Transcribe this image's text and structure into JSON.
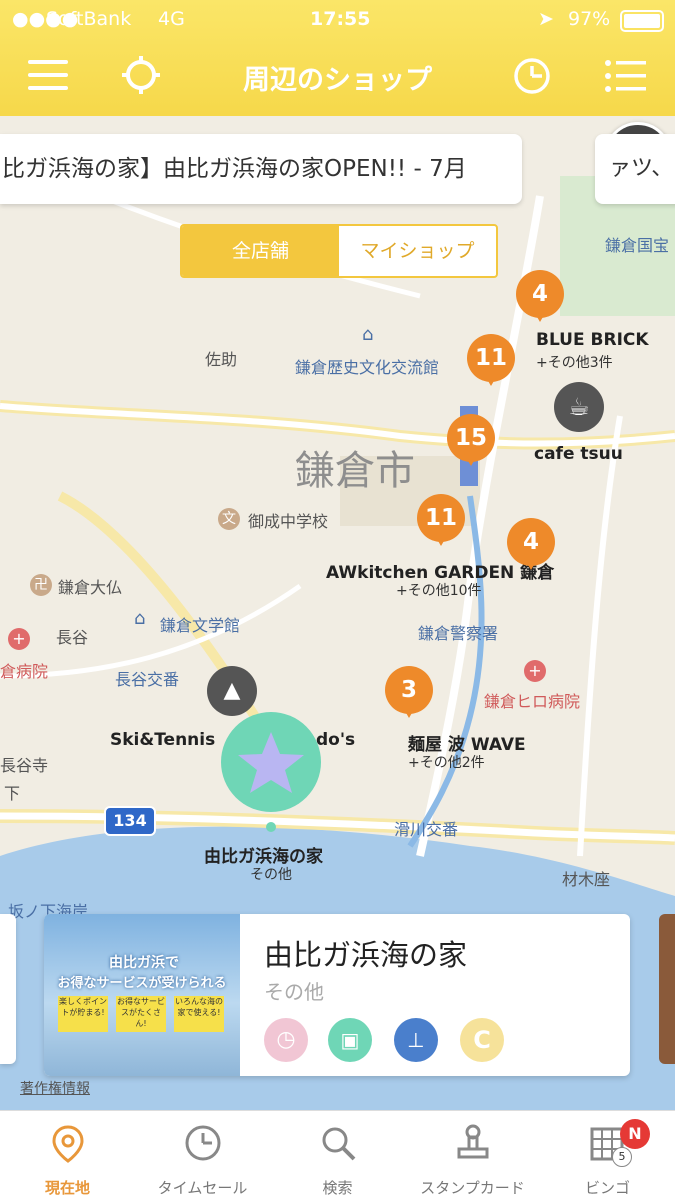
{
  "status_bar": {
    "carrier": "SoftBank",
    "network": "4G",
    "time": "17:55",
    "battery": "97%"
  },
  "header": {
    "title": "周辺のショップ"
  },
  "ticker": {
    "text": "比ガ浜海の家】由比ガ浜海の家OPEN!! - 7月",
    "text2": "ァツ、"
  },
  "segment": {
    "all_label": "全店舗",
    "my_label": "マイショップ"
  },
  "map_labels": {
    "sasuke": "佐助",
    "kamakura_city": "鎌倉市",
    "kamakura_history": "鎌倉歴史文化交流館",
    "onari": "御成中学校",
    "daibutsu": "鎌倉大仏",
    "hase": "長谷",
    "bungakukan": "鎌倉文学館",
    "hase_koban": "長谷交番",
    "hospital_left": "倉病院",
    "hasedera": "長谷寺",
    "shita": "下",
    "kokuho": "鎌倉国宝",
    "police": "鎌倉警察署",
    "hiro_hospital": "鎌倉ヒロ病院",
    "namerikawa": "滑川交番",
    "zaimokuza": "材木座",
    "sakanoshita": "坂ノ下海岸",
    "route": "134",
    "copyright": "著作権情報"
  },
  "shops": {
    "blue_brick": {
      "name": "BLUE BRICK",
      "sub": "+その他3件",
      "count": "4"
    },
    "count11a": "11",
    "count15": "15",
    "cafe": {
      "name": "cafe tsuu"
    },
    "awkitchen": {
      "name": "AWkitchen GARDEN 鎌倉",
      "sub": "+その他10件",
      "count": "11"
    },
    "count4b": "4",
    "wave": {
      "name": "麺屋 波 WAVE",
      "sub": "+その他2件",
      "count": "3"
    },
    "skitennis": {
      "name": "Ski&Tennis",
      "name2": "do's"
    },
    "yuigahama": {
      "name": "由比ガ浜海の家",
      "sub": "その他"
    }
  },
  "card": {
    "title": "由比ガ浜海の家",
    "category": "その他",
    "banner_line1": "由比ガ浜で",
    "banner_line2": "お得なサービスが受けられる",
    "badge1": "楽しくポイントが貯まる!",
    "badge2": "お得なサービスがたくさん!",
    "badge3": "いろんな海の家で使える!"
  },
  "tabs": [
    {
      "label": "現在地"
    },
    {
      "label": "タイムセール"
    },
    {
      "label": "検索"
    },
    {
      "label": "スタンプカード"
    },
    {
      "label": "ビンゴ",
      "badge": "N",
      "count": "5"
    }
  ],
  "colors": {
    "accent": "#f6d84a",
    "pin": "#ee8a2a",
    "active_tab": "#e8973a",
    "teal": "#6fd6b6"
  }
}
